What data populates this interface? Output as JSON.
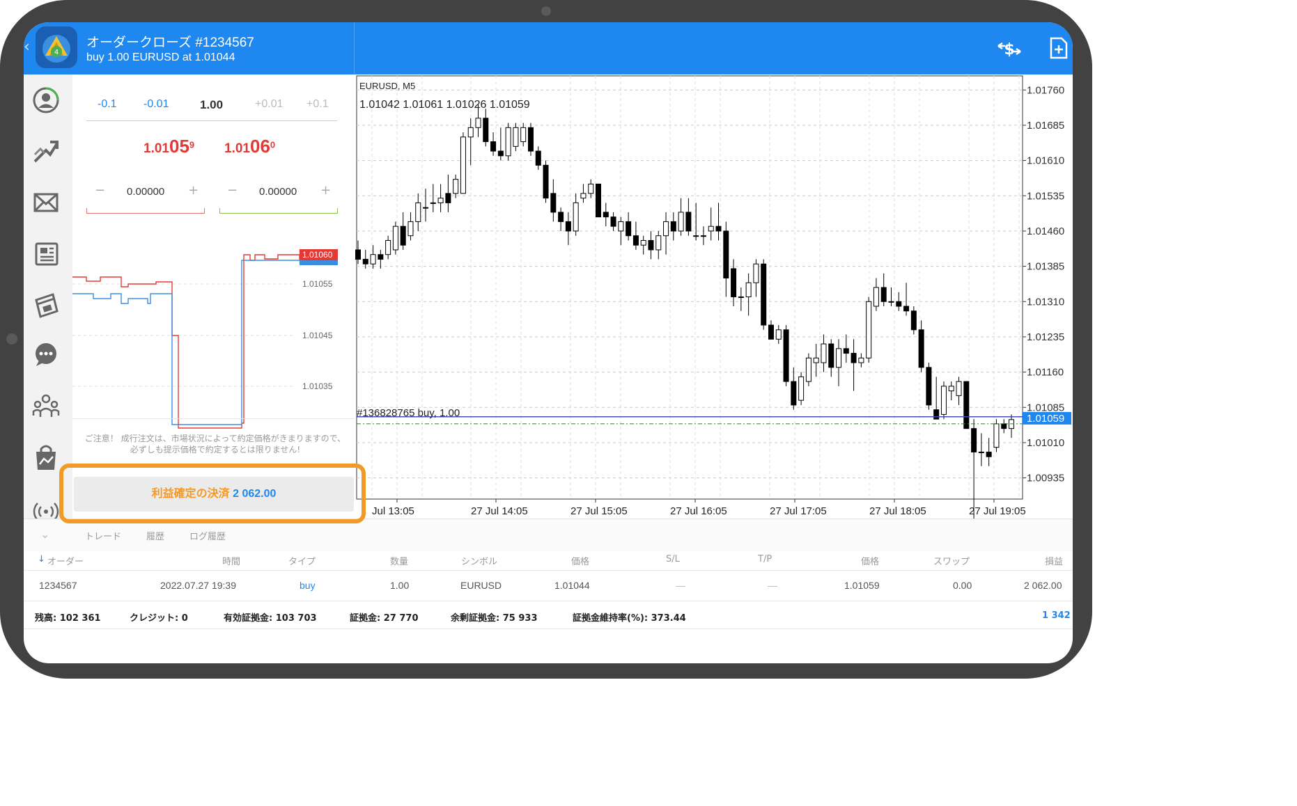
{
  "header": {
    "title": "オーダークローズ #1234567",
    "subtitle": "buy 1.00 EURUSD at 1.01044"
  },
  "order_panel": {
    "volume_steps": [
      "-0.1",
      "-0.01",
      "1.00",
      "+0.01",
      "+0.1"
    ],
    "bid": {
      "prefix": "1.01",
      "big": "05",
      "sup": "9"
    },
    "ask": {
      "prefix": "1.01",
      "big": "06",
      "sup": "0"
    },
    "sl_value": "0.00000",
    "tp_value": "0.00000",
    "tick_chart": {
      "price_labels": [
        "1.01055",
        "1.01045",
        "1.01035"
      ],
      "current_price": "1.01060"
    },
    "notice": "ご注意！ 成行注文は、市場状況によって約定価格がきまりますので、必ずしも提示価格で約定するとは限りません!",
    "close_button": {
      "label": "利益確定の決済",
      "amount": "2 062.00"
    }
  },
  "chart_data": {
    "type": "candlestick",
    "title": "EURUSD, M5",
    "ohlc_readout": "1.01042 1.01061 1.01026 1.01059",
    "y_ticks": [
      "1.01760",
      "1.01685",
      "1.01610",
      "1.01535",
      "1.01460",
      "1.01385",
      "1.01310",
      "1.01235",
      "1.01160",
      "1.01085",
      "1.01010",
      "1.00935"
    ],
    "ylim": [
      1.009,
      1.018
    ],
    "x_ticks": [
      "Jul 13:05",
      "27 Jul 14:05",
      "27 Jul 15:05",
      "27 Jul 16:05",
      "27 Jul 17:05",
      "27 Jul 18:05",
      "27 Jul 19:05"
    ],
    "position_line": {
      "label": "#136828765 buy, 1.00",
      "price": 1.01044
    },
    "current_price": {
      "label": "1.01059",
      "price": 1.01059
    },
    "candles": [
      [
        1.0142,
        1.0144,
        1.0139,
        1.014
      ],
      [
        1.014,
        1.0142,
        1.0138,
        1.0139
      ],
      [
        1.0139,
        1.0143,
        1.0138,
        1.0141
      ],
      [
        1.0141,
        1.0142,
        1.0138,
        1.014
      ],
      [
        1.0141,
        1.0145,
        1.014,
        1.0144
      ],
      [
        1.0142,
        1.0148,
        1.0141,
        1.0147
      ],
      [
        1.0147,
        1.015,
        1.0142,
        1.0143
      ],
      [
        1.0145,
        1.015,
        1.0144,
        1.0148
      ],
      [
        1.0148,
        1.0154,
        1.0146,
        1.0152
      ],
      [
        1.0151,
        1.0155,
        1.0148,
        1.0151
      ],
      [
        1.0152,
        1.0156,
        1.015,
        1.0152
      ],
      [
        1.0152,
        1.0156,
        1.015,
        1.0153
      ],
      [
        1.0154,
        1.0158,
        1.015,
        1.0152
      ],
      [
        1.0154,
        1.0158,
        1.0153,
        1.0157
      ],
      [
        1.0154,
        1.0167,
        1.0154,
        1.0166
      ],
      [
        1.0166,
        1.017,
        1.016,
        1.0168
      ],
      [
        1.0168,
        1.0173,
        1.0166,
        1.017
      ],
      [
        1.017,
        1.0172,
        1.0164,
        1.0165
      ],
      [
        1.0165,
        1.0167,
        1.0162,
        1.0163
      ],
      [
        1.0163,
        1.0168,
        1.0161,
        1.0162
      ],
      [
        1.0162,
        1.0169,
        1.0161,
        1.0168
      ],
      [
        1.0164,
        1.0169,
        1.0163,
        1.0168
      ],
      [
        1.0165,
        1.0169,
        1.0164,
        1.0168
      ],
      [
        1.0168,
        1.0169,
        1.0162,
        1.0163
      ],
      [
        1.0163,
        1.0164,
        1.0159,
        1.016
      ],
      [
        1.016,
        1.0161,
        1.0152,
        1.0153
      ],
      [
        1.0154,
        1.0157,
        1.0148,
        1.015
      ],
      [
        1.015,
        1.0151,
        1.0146,
        1.0148
      ],
      [
        1.0148,
        1.015,
        1.0143,
        1.0146
      ],
      [
        1.0146,
        1.0154,
        1.0145,
        1.0152
      ],
      [
        1.0153,
        1.0156,
        1.0152,
        1.0154
      ],
      [
        1.0154,
        1.0157,
        1.0153,
        1.0156
      ],
      [
        1.0156,
        1.0156,
        1.0149,
        1.0149
      ],
      [
        1.015,
        1.0152,
        1.0147,
        1.0149
      ],
      [
        1.0149,
        1.015,
        1.0146,
        1.0147
      ],
      [
        1.0146,
        1.0149,
        1.0143,
        1.0148
      ],
      [
        1.0148,
        1.015,
        1.0144,
        1.0145
      ],
      [
        1.0145,
        1.0148,
        1.0142,
        1.0143
      ],
      [
        1.0143,
        1.0145,
        1.0141,
        1.0144
      ],
      [
        1.0144,
        1.0146,
        1.014,
        1.0142
      ],
      [
        1.0142,
        1.0146,
        1.014,
        1.0145
      ],
      [
        1.0145,
        1.015,
        1.0141,
        1.0148
      ],
      [
        1.0148,
        1.015,
        1.0144,
        1.0146
      ],
      [
        1.0146,
        1.0153,
        1.0145,
        1.015
      ],
      [
        1.015,
        1.0153,
        1.0145,
        1.0146
      ],
      [
        1.0145,
        1.0152,
        1.0144,
        1.0145
      ],
      [
        1.0145,
        1.0147,
        1.0143,
        1.0145
      ],
      [
        1.0146,
        1.0151,
        1.0144,
        1.0147
      ],
      [
        1.0147,
        1.0152,
        1.0144,
        1.0146
      ],
      [
        1.0146,
        1.0148,
        1.0132,
        1.0136
      ],
      [
        1.0138,
        1.014,
        1.013,
        1.0132
      ],
      [
        1.0132,
        1.0134,
        1.0129,
        1.0132
      ],
      [
        1.0132,
        1.0137,
        1.0128,
        1.0135
      ],
      [
        1.0135,
        1.014,
        1.0132,
        1.0139
      ],
      [
        1.0139,
        1.014,
        1.0125,
        1.0126
      ],
      [
        1.0126,
        1.0127,
        1.0123,
        1.0123
      ],
      [
        1.0123,
        1.0126,
        1.0122,
        1.0125
      ],
      [
        1.0125,
        1.0126,
        1.0113,
        1.0114
      ],
      [
        1.0114,
        1.0117,
        1.0108,
        1.0109
      ],
      [
        1.011,
        1.0116,
        1.0109,
        1.0115
      ],
      [
        1.0114,
        1.012,
        1.0113,
        1.0119
      ],
      [
        1.0118,
        1.0122,
        1.0115,
        1.0119
      ],
      [
        1.0118,
        1.0124,
        1.0116,
        1.0122
      ],
      [
        1.0122,
        1.0123,
        1.0115,
        1.0117
      ],
      [
        1.0117,
        1.0123,
        1.0113,
        1.0121
      ],
      [
        1.0121,
        1.0124,
        1.0118,
        1.012
      ],
      [
        1.012,
        1.0123,
        1.0112,
        1.0118
      ],
      [
        1.0118,
        1.012,
        1.0117,
        1.0119
      ],
      [
        1.0119,
        1.0132,
        1.0118,
        1.0131
      ],
      [
        1.013,
        1.0136,
        1.0129,
        1.0134
      ],
      [
        1.0134,
        1.0137,
        1.013,
        1.0131
      ],
      [
        1.0131,
        1.0134,
        1.013,
        1.0131
      ],
      [
        1.0131,
        1.0133,
        1.0129,
        1.013
      ],
      [
        1.013,
        1.0135,
        1.0128,
        1.0129
      ],
      [
        1.0129,
        1.013,
        1.0124,
        1.0125
      ],
      [
        1.0125,
        1.0127,
        1.0116,
        1.0117
      ],
      [
        1.0117,
        1.0118,
        1.0108,
        1.0109
      ],
      [
        1.0108,
        1.0115,
        1.0106,
        1.0106
      ],
      [
        1.0107,
        1.0114,
        1.0106,
        1.0113
      ],
      [
        1.0112,
        1.0114,
        1.011,
        1.0113
      ],
      [
        1.0111,
        1.0115,
        1.0109,
        1.0114
      ],
      [
        1.0114,
        1.0114,
        1.0105,
        1.0104
      ],
      [
        1.0104,
        1.0106,
        0.9998,
        1.0099
      ],
      [
        1.0099,
        1.0103,
        1.0096,
        1.0099
      ],
      [
        1.0099,
        1.0102,
        1.0096,
        1.0098
      ],
      [
        1.01,
        1.0106,
        1.0099,
        1.0105
      ],
      [
        1.0105,
        1.0106,
        1.0103,
        1.0104
      ],
      [
        1.0104,
        1.0107,
        1.0102,
        1.01059
      ]
    ]
  },
  "bottom": {
    "tabs": [
      "トレード",
      "履歴",
      "ログ履歴"
    ],
    "columns": [
      "オーダー",
      "時間",
      "タイプ",
      "数量",
      "シンボル",
      "価格",
      "S/L",
      "T/P",
      "価格",
      "スワップ",
      "損益"
    ],
    "row": [
      "1234567",
      "2022.07.27 19:39",
      "buy",
      "1.00",
      "EURUSD",
      "1.01044",
      "—",
      "—",
      "1.01059",
      "0.00",
      "2 062.00"
    ],
    "summary": {
      "balance_label": "残高:",
      "balance": "102 361",
      "credit_label": "クレジット:",
      "credit": "0",
      "equity_label": "有効証拠金:",
      "equity": "103 703",
      "margin_label": "証拠金:",
      "margin": "27 770",
      "free_margin_label": "余剰証拠金:",
      "free_margin": "75 933",
      "margin_level_label": "証拠金維持率(%):",
      "margin_level": "373.44",
      "profit": "1 342"
    }
  },
  "colors": {
    "accent": "#1e88f0",
    "sell": "#e53935",
    "buy_tp": "#8bc34a",
    "highlight": "#f29a27"
  }
}
